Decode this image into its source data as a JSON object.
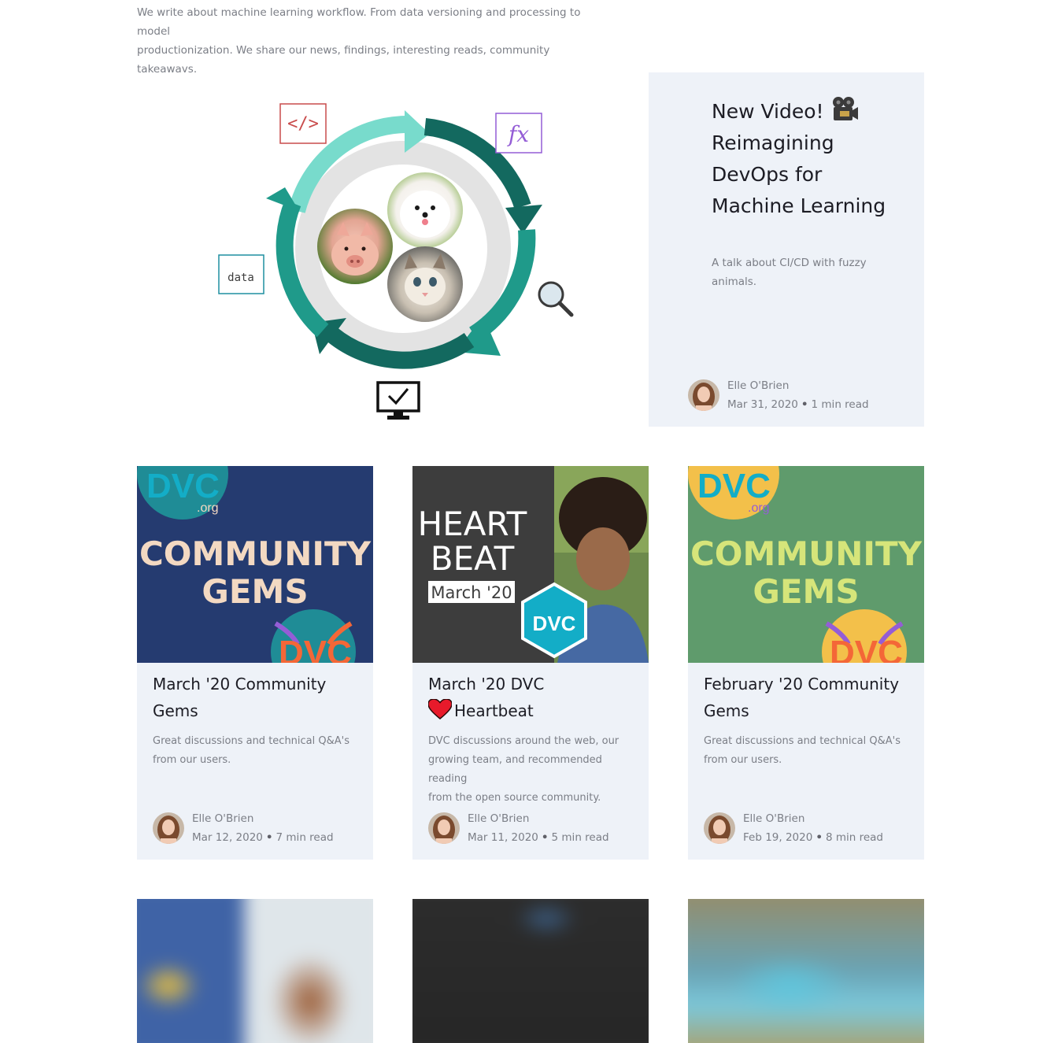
{
  "intro": {
    "line1": "We write about machine learning workflow. From data versioning and processing to model",
    "line2": "productionization. We share our news, findings, interesting reads, community takeaways."
  },
  "featured": {
    "title_line1": "New Video!",
    "title_line2": "Reimagining",
    "title_line3": "DevOps for",
    "title_line4": "Machine Learning",
    "title_icon": "movie-camera-icon",
    "description_line1": "A talk about CI/CD with fuzzy",
    "description_line2": "animals.",
    "author": "Elle O'Brien",
    "date": "Mar 31, 2020",
    "read_time": "1 min read",
    "diagram": {
      "code_label": "</>",
      "fx_label": "fx",
      "data_label": "data"
    }
  },
  "posts": [
    {
      "title_line1": "March '20 Community",
      "title_line2": "Gems",
      "description_line1": "Great discussions and technical Q&A's",
      "description_line2": "from our users.",
      "description_line3": "",
      "author": "Elle O'Brien",
      "date": "Mar 12, 2020",
      "read_time": "7 min read",
      "image": {
        "top_text": "COMMUNITY",
        "bottom_text": "GEMS",
        "logo": "DVC",
        "org": ".org",
        "bg": "#253b70",
        "text_color": "#f3d9c2"
      }
    },
    {
      "title_line1": "March '20 DVC",
      "title_line2": "Heartbeat",
      "title_icon": "heart-icon",
      "description_line1": "DVC discussions around the web, our",
      "description_line2": "growing team, and recommended reading",
      "description_line3": "from the open source community.",
      "author": "Elle O'Brien",
      "date": "Mar 11, 2020",
      "read_time": "5 min read",
      "image": {
        "line1": "HEART",
        "line2": "BEAT",
        "line3": "March '20",
        "logo": "DVC",
        "bg": "#3d3d3d"
      }
    },
    {
      "title_line1": "February '20 Community",
      "title_line2": "Gems",
      "description_line1": "Great discussions and technical Q&A's",
      "description_line2": "from our users.",
      "description_line3": "",
      "author": "Elle O'Brien",
      "date": "Feb 19, 2020",
      "read_time": "8 min read",
      "image": {
        "top_text": "COMMUNITY",
        "bottom_text": "GEMS",
        "logo": "DVC",
        "org": ".org",
        "bg": "#5f9b6c",
        "text_color": "#d6e57a"
      }
    }
  ],
  "colors": {
    "card_bg": "#eef2f8",
    "teal_dark": "#13695f",
    "teal_mid": "#1f9a8a",
    "teal_light": "#78dbcc",
    "dvc_purple": "#945dd6",
    "dvc_orange": "#f46737",
    "dvc_blue": "#13adc7"
  }
}
